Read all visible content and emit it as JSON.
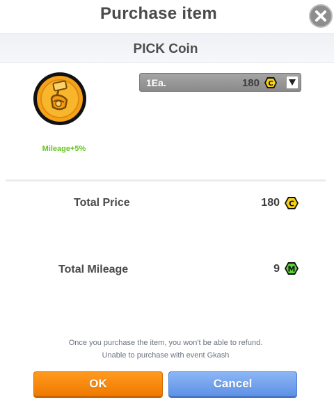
{
  "dialog": {
    "title": "Purchase item",
    "close_icon": "close-icon"
  },
  "item": {
    "name": "PICK Coin",
    "icon": "claw-coin-icon",
    "bonus": "Mileage+5%"
  },
  "quantity": {
    "selected": "1Ea.",
    "price": "180",
    "currency_icon": "c-coin-icon",
    "dropdown_icon": "chevron-down-icon"
  },
  "totals": {
    "price_label": "Total Price",
    "price_value": "180",
    "price_currency_icon": "c-coin-icon",
    "mileage_label": "Total Mileage",
    "mileage_value": "9",
    "mileage_icon": "m-mileage-icon"
  },
  "notice": {
    "line1": "Once you purchase the item, you won't be able to refund.",
    "line2": "Unable to purchase with event Gkash"
  },
  "buttons": {
    "ok": "OK",
    "cancel": "Cancel"
  },
  "colors": {
    "accent_orange": "#f5870b",
    "accent_blue": "#6f9fe9",
    "mileage_green": "#66c421",
    "coin_yellow": "#f7d312"
  }
}
